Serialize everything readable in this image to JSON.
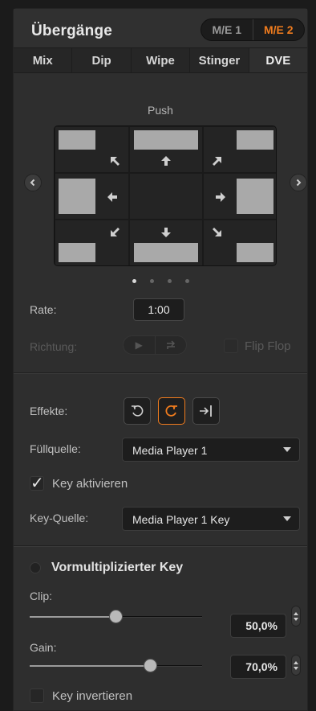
{
  "header": {
    "title": "Übergänge",
    "me_buttons": [
      {
        "label": "M/E 1",
        "active": false
      },
      {
        "label": "M/E 2",
        "active": true
      }
    ]
  },
  "tabs": [
    {
      "label": "Mix",
      "active": false
    },
    {
      "label": "Dip",
      "active": false
    },
    {
      "label": "Wipe",
      "active": false
    },
    {
      "label": "Stinger",
      "active": false
    },
    {
      "label": "DVE",
      "active": true
    }
  ],
  "dve": {
    "pattern_name": "Push",
    "pattern_page": 1,
    "pattern_page_count": 4,
    "nav_prev_icon": "chevron-left-icon",
    "nav_next_icon": "chevron-right-icon"
  },
  "rate": {
    "label": "Rate:",
    "value": "1:00"
  },
  "direction": {
    "label": "Richtung:",
    "flip_flop_label": "Flip Flop"
  },
  "effects": {
    "label": "Effekte:",
    "buttons": [
      {
        "icon": "rotate-ccw-icon",
        "active": false
      },
      {
        "icon": "rotate-cw-icon",
        "active": true
      },
      {
        "icon": "arrow-right-bar-icon",
        "active": false
      }
    ]
  },
  "fill_source": {
    "label": "Füllquelle:",
    "value": "Media Player 1"
  },
  "key_enable": {
    "label": "Key aktivieren",
    "checked": true
  },
  "key_source": {
    "label": "Key-Quelle:",
    "value": "Media Player 1 Key"
  },
  "premult": {
    "label": "Vormultiplizierter Key",
    "enabled": false
  },
  "clip": {
    "label": "Clip:",
    "value": "50,0%",
    "fraction": 0.5
  },
  "gain": {
    "label": "Gain:",
    "value": "70,0%",
    "fraction": 0.7
  },
  "invert": {
    "label": "Key invertieren",
    "checked": false
  },
  "colors": {
    "accent": "#f07c1e",
    "panel": "#2e2e2e",
    "background": "#1b1b1b"
  }
}
